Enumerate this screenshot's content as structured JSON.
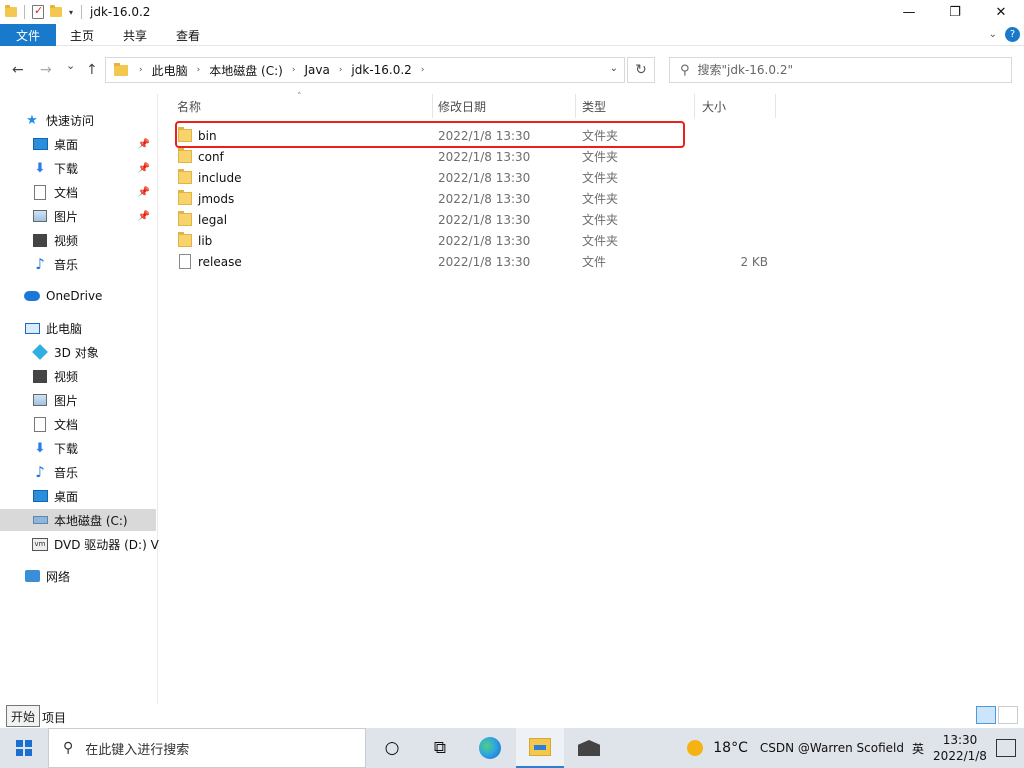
{
  "window": {
    "title": "jdk-16.0.2",
    "minimize_glyph": "—",
    "maximize_glyph": "❐",
    "close_glyph": "✕"
  },
  "ribbon": {
    "file_tab": "文件",
    "tabs": [
      "主页",
      "共享",
      "查看"
    ]
  },
  "address": {
    "back_glyph": "←",
    "forward_glyph": "→",
    "recent_glyph": "⌄",
    "up_glyph": "↑",
    "breadcrumbs": [
      "此电脑",
      "本地磁盘 (C:)",
      "Java",
      "jdk-16.0.2"
    ],
    "crumb_sep": "›",
    "refresh_glyph": "↻",
    "search_placeholder": "搜索\"jdk-16.0.2\""
  },
  "nav": {
    "quick_access": "快速访问",
    "quick_items": [
      {
        "label": "桌面",
        "icon": "desktop-icon"
      },
      {
        "label": "下载",
        "icon": "download-icon"
      },
      {
        "label": "文档",
        "icon": "documents-icon"
      },
      {
        "label": "图片",
        "icon": "pictures-icon"
      },
      {
        "label": "视频",
        "icon": "videos-icon"
      },
      {
        "label": "音乐",
        "icon": "music-icon"
      }
    ],
    "onedrive": "OneDrive",
    "this_pc": "此电脑",
    "pc_items": [
      {
        "label": "3D 对象",
        "icon": "3d-objects-icon"
      },
      {
        "label": "视频",
        "icon": "videos-icon"
      },
      {
        "label": "图片",
        "icon": "pictures-icon"
      },
      {
        "label": "文档",
        "icon": "documents-icon"
      },
      {
        "label": "下载",
        "icon": "download-icon"
      },
      {
        "label": "音乐",
        "icon": "music-icon"
      },
      {
        "label": "桌面",
        "icon": "desktop-icon"
      },
      {
        "label": "本地磁盘 (C:)",
        "icon": "drive-icon"
      },
      {
        "label": "DVD 驱动器 (D:) V",
        "icon": "dvd-drive-icon"
      }
    ],
    "network": "网络"
  },
  "columns": {
    "name": "名称",
    "date": "修改日期",
    "type": "类型",
    "size": "大小"
  },
  "files": [
    {
      "name": "bin",
      "date": "2022/1/8 13:30",
      "type": "文件夹",
      "size": "",
      "kind": "folder"
    },
    {
      "name": "conf",
      "date": "2022/1/8 13:30",
      "type": "文件夹",
      "size": "",
      "kind": "folder"
    },
    {
      "name": "include",
      "date": "2022/1/8 13:30",
      "type": "文件夹",
      "size": "",
      "kind": "folder"
    },
    {
      "name": "jmods",
      "date": "2022/1/8 13:30",
      "type": "文件夹",
      "size": "",
      "kind": "folder"
    },
    {
      "name": "legal",
      "date": "2022/1/8 13:30",
      "type": "文件夹",
      "size": "",
      "kind": "folder"
    },
    {
      "name": "lib",
      "date": "2022/1/8 13:30",
      "type": "文件夹",
      "size": "",
      "kind": "folder"
    },
    {
      "name": "release",
      "date": "2022/1/8 13:30",
      "type": "文件",
      "size": "2 KB",
      "kind": "file"
    }
  ],
  "highlight_color": "#e8221b",
  "status": {
    "item_count_suffix": "项目",
    "tooltip": "开始"
  },
  "taskbar": {
    "search_placeholder": "在此键入进行搜索",
    "temperature": "18°C",
    "tray_text": "CSDN @Warren Scofield",
    "time": "13:30",
    "date": "2022/1/8",
    "lang": "英"
  },
  "accent_color": "#1979ca"
}
